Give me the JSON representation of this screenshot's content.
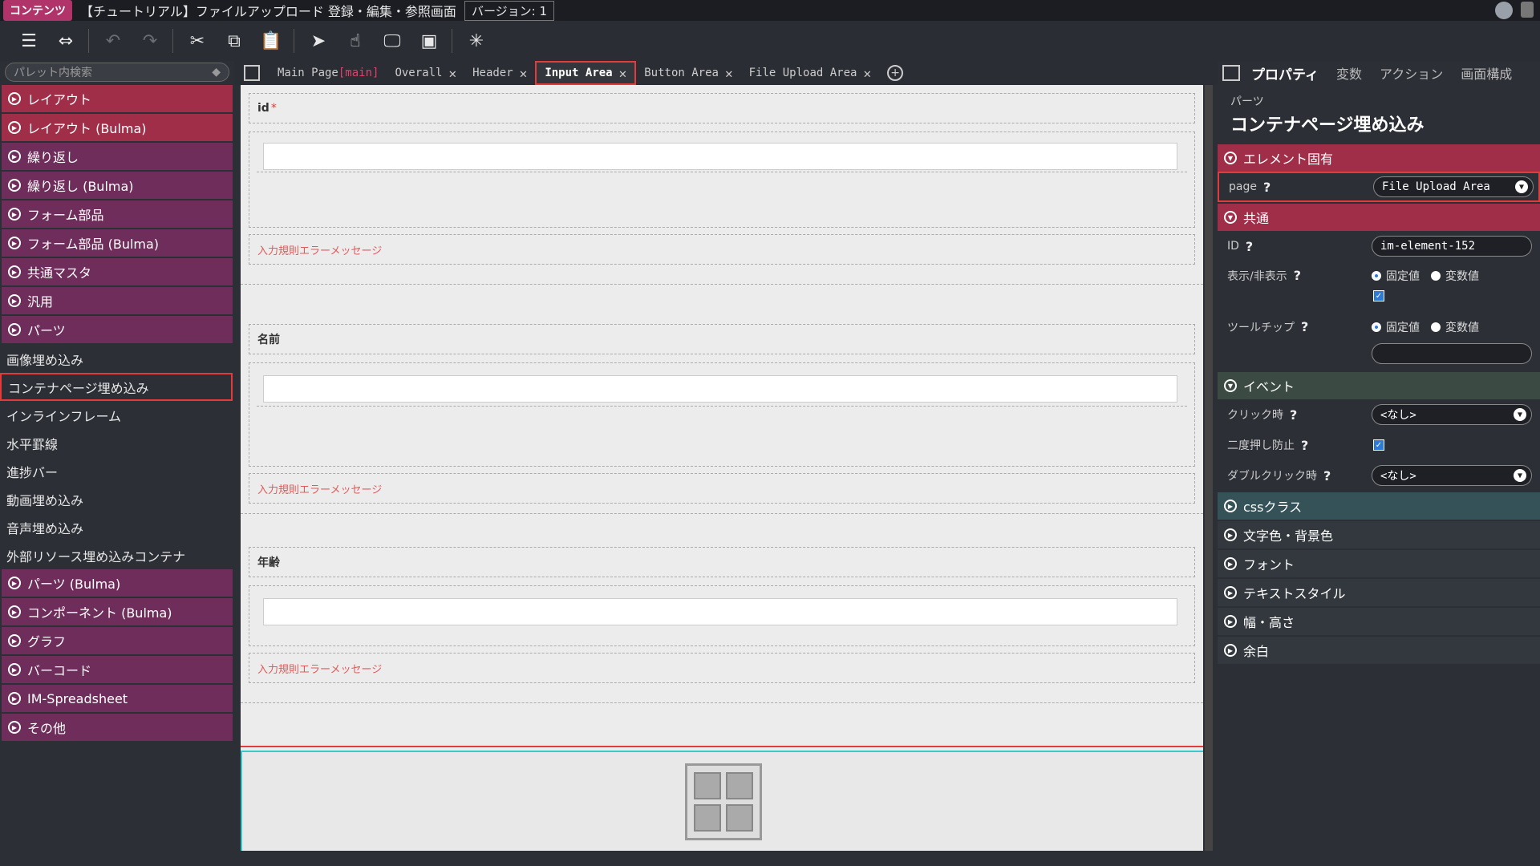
{
  "titlebar": {
    "app_badge": "コンテンツ",
    "title": "【チュートリアル】ファイルアップロード 登録・編集・参照画面",
    "version": "バージョン: 1"
  },
  "palette": {
    "search_placeholder": "パレット内検索",
    "categories_top": [
      {
        "label": "レイアウト",
        "color": "red"
      },
      {
        "label": "レイアウト (Bulma)",
        "color": "red"
      },
      {
        "label": "繰り返し",
        "color": "purple"
      },
      {
        "label": "繰り返し (Bulma)",
        "color": "purple"
      },
      {
        "label": "フォーム部品",
        "color": "purple"
      },
      {
        "label": "フォーム部品 (Bulma)",
        "color": "purple"
      },
      {
        "label": "共通マスタ",
        "color": "purple"
      },
      {
        "label": "汎用",
        "color": "purple"
      },
      {
        "label": "パーツ",
        "color": "purple"
      }
    ],
    "parts_items": [
      "画像埋め込み",
      "コンテナページ埋め込み",
      "インラインフレーム",
      "水平罫線",
      "進捗バー",
      "動画埋め込み",
      "音声埋め込み",
      "外部リソース埋め込みコンテナ"
    ],
    "selected_item": "コンテナページ埋め込み",
    "categories_bottom": [
      "パーツ (Bulma)",
      "コンポーネント (Bulma)",
      "グラフ",
      "バーコード",
      "IM-Spreadsheet",
      "その他"
    ]
  },
  "tabs": {
    "main_page": "Main Page",
    "main_tag": "[main]",
    "items": [
      "Overall",
      "Header",
      "Input Area",
      "Button Area",
      "File Upload Area"
    ],
    "active": "Input Area"
  },
  "canvas": {
    "field1_label": "id",
    "field1_required": "*",
    "field2_label": "名前",
    "field3_label": "年齢",
    "error_message": "入力規則エラーメッセージ"
  },
  "properties": {
    "tabs": [
      "プロパティ",
      "変数",
      "アクション",
      "画面構成"
    ],
    "active_tab": "プロパティ",
    "parts_label": "パーツ",
    "parts_title": "コンテナページ埋め込み",
    "sec_element": "エレメント固有",
    "page_label": "page",
    "page_value": "File Upload Area",
    "sec_common": "共通",
    "id_label": "ID",
    "id_value": "im-element-152",
    "visibility_label": "表示/非表示",
    "tooltip_label": "ツールチップ",
    "radio_fixed": "固定値",
    "radio_variable": "変数値",
    "sec_event": "イベント",
    "click_label": "クリック時",
    "click_value": "<なし>",
    "double_press_label": "二度押し防止",
    "dblclick_label": "ダブルクリック時",
    "dblclick_value": "<なし>",
    "sec_css": "cssクラス",
    "sec_color": "文字色・背景色",
    "sec_font": "フォント",
    "sec_textstyle": "テキストスタイル",
    "sec_size": "幅・高さ",
    "sec_margin": "余白",
    "question_mark": "?"
  }
}
